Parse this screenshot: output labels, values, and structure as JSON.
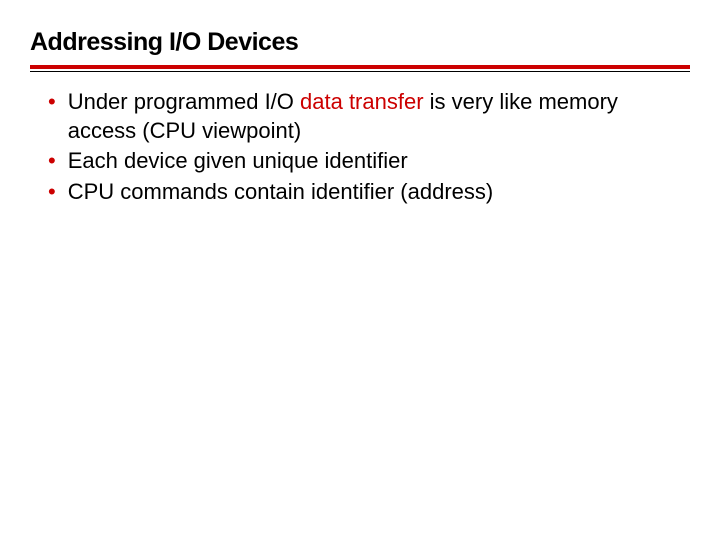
{
  "title": "Addressing I/O Devices",
  "colors": {
    "accent": "#cc0000",
    "text": "#000000"
  },
  "bullets": [
    {
      "pre": "Under programmed I/O ",
      "highlight": "data transfer",
      "post": " is very like memory access (CPU viewpoint)"
    },
    {
      "pre": "Each device given unique identifier",
      "highlight": "",
      "post": ""
    },
    {
      "pre": "CPU commands contain identifier (address)",
      "highlight": "",
      "post": ""
    }
  ]
}
